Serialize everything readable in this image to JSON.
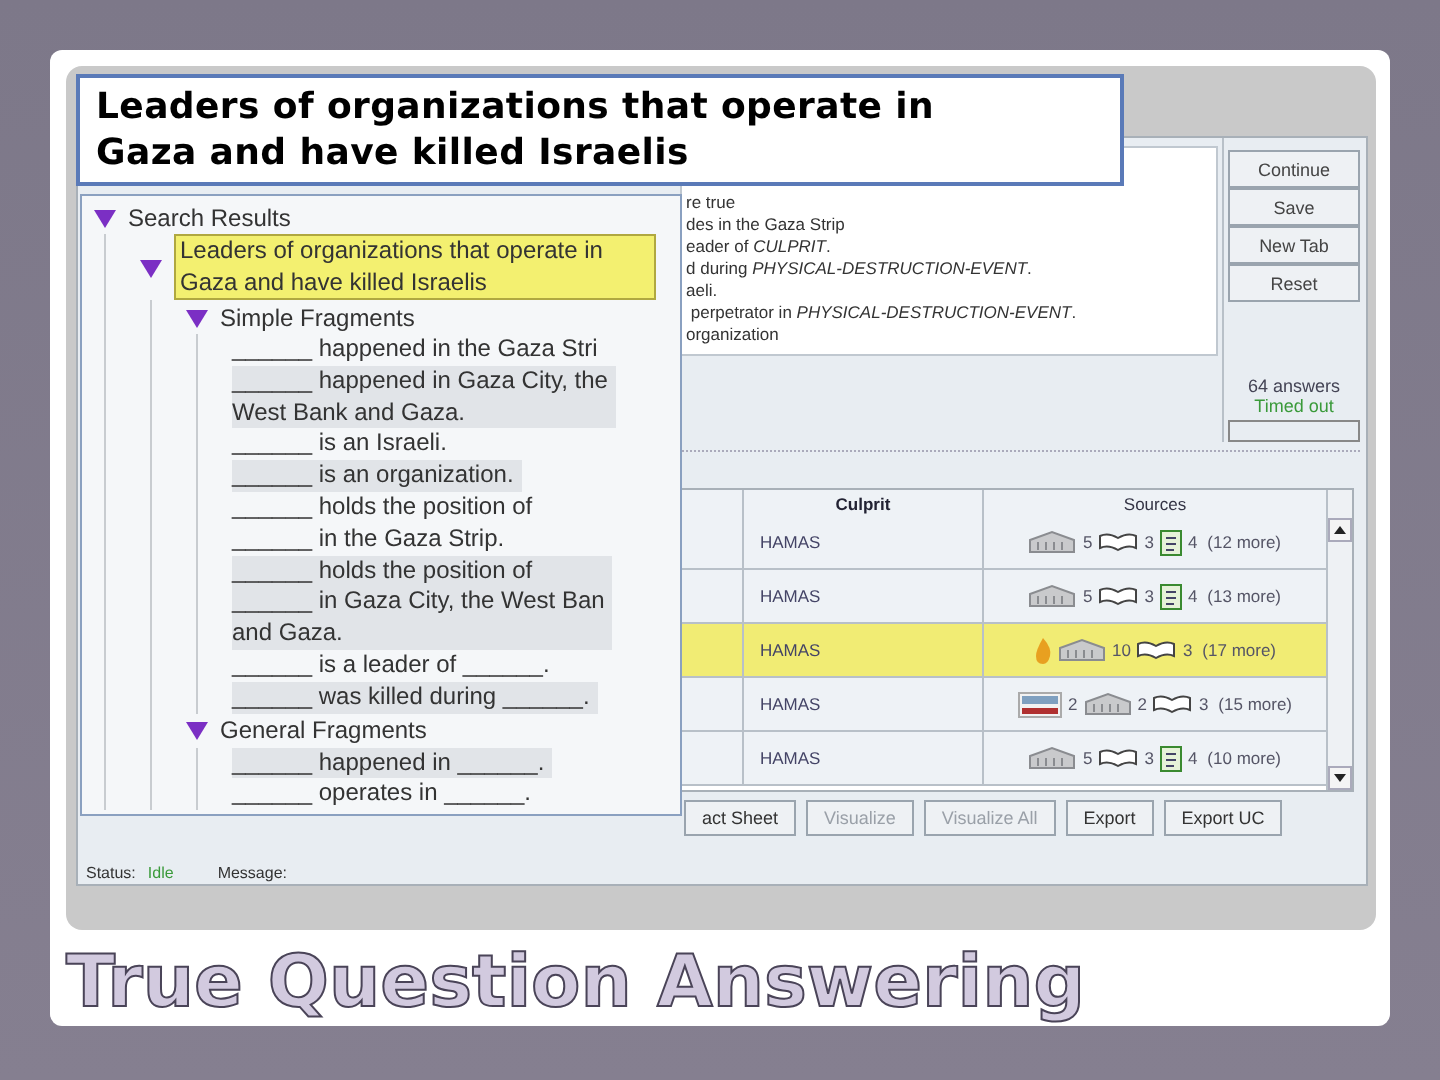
{
  "callout": {
    "text": "Leaders of organizations that operate in Gaza and have killed Israelis"
  },
  "tree": {
    "label": "Search Results",
    "expanded": true,
    "children": [
      {
        "label": "Leaders of organizations that operate in Gaza and have killed Israelis",
        "selected": true,
        "expanded": true,
        "children": [
          {
            "label": "Simple Fragments",
            "expanded": true,
            "children": [
              {
                "lines": [
                  "______ happened in the Gaza Stri"
                ],
                "shaded": false
              },
              {
                "lines": [
                  "______ happened in Gaza City, the",
                  "West Bank and Gaza."
                ],
                "shaded": true
              },
              {
                "lines": [
                  "______ is an Israeli."
                ],
                "shaded": false
              },
              {
                "lines": [
                  "______ is an organization."
                ],
                "shaded": true
              },
              {
                "lines": [
                  "______ holds the position of",
                  "______ in the Gaza Strip."
                ],
                "shaded": false
              },
              {
                "lines": [
                  "______ holds the position of",
                  "______ in Gaza City, the West Ban",
                  "and Gaza."
                ],
                "shaded": true
              },
              {
                "lines": [
                  "______ is a leader of ______."
                ],
                "shaded": false
              },
              {
                "lines": [
                  "______ was killed during ______."
                ],
                "shaded": true
              }
            ]
          },
          {
            "label": "General Fragments",
            "expanded": true,
            "children": [
              {
                "lines": [
                  "______ happened in ______."
                ],
                "shaded": true
              },
              {
                "lines": [
                  "______ operates in ______."
                ],
                "shaded": false
              }
            ]
          }
        ]
      }
    ]
  },
  "text_panel": {
    "lines": [
      "re true",
      "des in the Gaza Strip",
      "eader of *CULPRIT*.",
      "d during *PHYSICAL-DESTRUCTION-EVENT*.",
      "aeli.",
      " perpetrator in *PHYSICAL-DESTRUCTION-EVENT*.",
      "organization"
    ]
  },
  "side_buttons": [
    "Continue",
    "Save",
    "New Tab",
    "Reset"
  ],
  "answers": {
    "count": "64 answers",
    "status": "Timed out",
    "level": 0
  },
  "table": {
    "columns": [
      "Culprit",
      "Sources"
    ],
    "rows": [
      {
        "culprit": "HAMAS",
        "selected": false,
        "sources": [
          {
            "kind": "building",
            "count": "5"
          },
          {
            "kind": "book",
            "count": "3"
          },
          {
            "kind": "document",
            "count": "4"
          }
        ],
        "more": "(12 more)"
      },
      {
        "culprit": "HAMAS",
        "selected": false,
        "sources": [
          {
            "kind": "building",
            "count": "5"
          },
          {
            "kind": "book",
            "count": "3"
          },
          {
            "kind": "document",
            "count": "4"
          }
        ],
        "more": "(13 more)"
      },
      {
        "culprit": "HAMAS",
        "selected": true,
        "sources": [
          {
            "kind": "fire"
          },
          {
            "kind": "building",
            "count": "10"
          },
          {
            "kind": "book",
            "count": "3"
          }
        ],
        "more": "(17 more)"
      },
      {
        "culprit": "HAMAS",
        "selected": false,
        "sources": [
          {
            "kind": "news",
            "count": "2"
          },
          {
            "kind": "building",
            "count": "2"
          },
          {
            "kind": "book",
            "count": "3"
          }
        ],
        "more": "(15 more)"
      },
      {
        "culprit": "HAMAS",
        "selected": false,
        "sources": [
          {
            "kind": "building",
            "count": "5"
          },
          {
            "kind": "book",
            "count": "3"
          },
          {
            "kind": "document",
            "count": "4"
          }
        ],
        "more": "(10 more)"
      }
    ]
  },
  "bottom_buttons": [
    {
      "label": "act Sheet",
      "disabled": false
    },
    {
      "label": "Visualize",
      "disabled": true
    },
    {
      "label": "Visualize All",
      "disabled": true
    },
    {
      "label": "Export",
      "disabled": false
    },
    {
      "label": "Export UC",
      "disabled": false
    }
  ],
  "status_bar": {
    "label": "Status:",
    "value": "Idle",
    "message_label": "Message:"
  },
  "slide_title": "True Question Answering"
}
